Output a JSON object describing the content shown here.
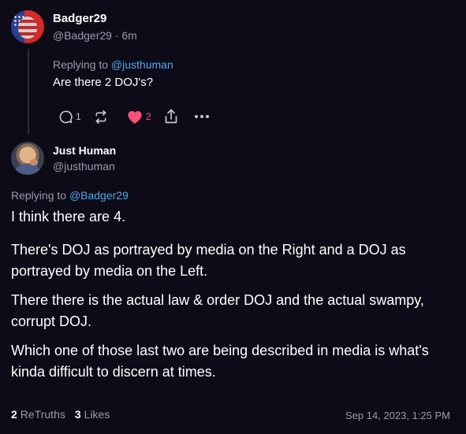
{
  "reply": {
    "display_name": "Badger29",
    "handle_line": "@Badger29 · 6m",
    "replying_prefix": "Replying to ",
    "replying_mention": "@justhuman",
    "text": "Are there 2 DOJ's?",
    "actions": {
      "reply_count": "1",
      "like_count": "2"
    },
    "icons": [
      "reply-icon",
      "retruth-icon",
      "heart-icon",
      "share-icon",
      "more-icon"
    ],
    "like_color": "#ff4f7b"
  },
  "post": {
    "display_name": "Just Human",
    "handle": "@justhuman",
    "replying_prefix": "Replying to ",
    "replying_mention": "@Badger29",
    "paragraphs": [
      "I think there are 4.",
      "There's DOJ as portrayed by media on the Right and a DOJ as portrayed by media on the Left.",
      "There there is the actual law & order DOJ and the actual swampy, corrupt DOJ.",
      "Which one of those last two are being described in media is what's kinda difficult to discern at times."
    ],
    "stats": {
      "retruths_count": "2",
      "retruths_label": "ReTruths",
      "likes_count": "3",
      "likes_label": "Likes"
    },
    "timestamp": "Sep 14, 2023, 1:25 PM"
  },
  "colors": {
    "background": "#0d0b18",
    "mention": "#4ea6e8",
    "muted": "#9c9aab"
  }
}
